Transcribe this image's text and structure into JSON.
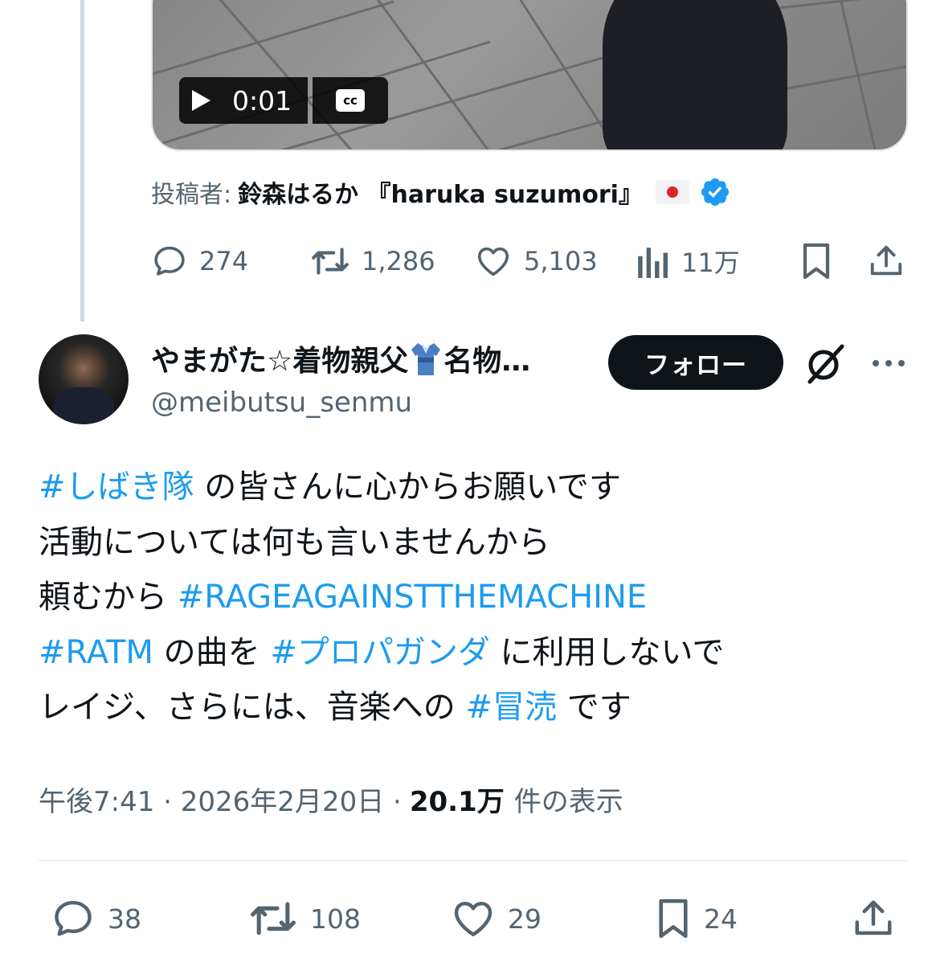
{
  "video": {
    "time": "0:01",
    "cc_label": "cc"
  },
  "quoted": {
    "poster_label": "投稿者:",
    "poster_name": "鈴森はるか 『haruka suzumori』",
    "stats": {
      "replies": "274",
      "reposts": "1,286",
      "likes": "5,103",
      "views": "11万"
    }
  },
  "author": {
    "name_before": "やまがた☆着物親父",
    "name_after": "名物…",
    "handle": "@meibutsu_senmu",
    "follow_label": "フォロー"
  },
  "tweet": {
    "lines": [
      [
        {
          "t": "#しばき隊",
          "tag": true
        },
        {
          "t": " の皆さんに心からお願いです",
          "tag": false
        }
      ],
      [
        {
          "t": "活動については何も言いませんから",
          "tag": false
        }
      ],
      [
        {
          "t": "頼むから ",
          "tag": false
        },
        {
          "t": "#RAGEAGAINSTTHEMACHINE",
          "tag": true
        }
      ],
      [
        {
          "t": "#RATM",
          "tag": true
        },
        {
          "t": " の曲を ",
          "tag": false
        },
        {
          "t": "#プロパガンダ",
          "tag": true
        },
        {
          "t": " に利用しないで",
          "tag": false
        }
      ],
      [
        {
          "t": "レイジ、さらには、音楽への ",
          "tag": false
        },
        {
          "t": "#冒涜",
          "tag": true
        },
        {
          "t": " です",
          "tag": false
        }
      ]
    ],
    "time": "午後7:41 · 2026年2月20日 ·",
    "views_count": "20.1万",
    "views_label": "件の表示"
  },
  "stats": {
    "replies": "38",
    "reposts": "108",
    "likes": "29",
    "bookmarks": "24"
  },
  "colors": {
    "accent": "#1d9bf0",
    "text": "#0f1419",
    "muted": "#536471",
    "border": "#eff3f4"
  },
  "icons": [
    "play-icon",
    "cc-icon",
    "verified-icon",
    "reply-icon",
    "repost-icon",
    "like-icon",
    "views-icon",
    "bookmark-icon",
    "share-icon",
    "grok-icon",
    "more-icon",
    "kimono-icon"
  ]
}
